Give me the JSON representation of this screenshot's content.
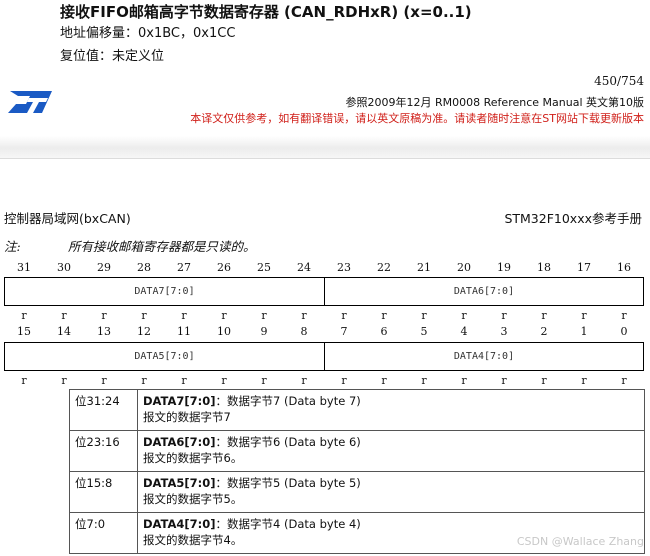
{
  "header": {
    "title": "接收FIFO邮箱高字节数据寄存器 (CAN_RDHxR) (x=0..1)",
    "offset": "地址偏移量：0x1BC，0x1CC",
    "reset": "复位值：未定义位"
  },
  "page_header": {
    "page_number": "450/754",
    "reference_line": "参照2009年12月 RM0008 Reference Manual 英文第10版",
    "disclaimer": "本译文仅供参考，如有翻译错误，请以英文原稿为准。请读者随时注意在ST网站下载更新版本",
    "logo_icon": "st-logo-icon",
    "logo_color": "#1a5ac4"
  },
  "section": {
    "left": "控制器局域网(bxCAN)",
    "right": "STM32F10xxx参考手册"
  },
  "note": {
    "label": "注:",
    "text": "所有接收邮箱寄存器都是只读的。"
  },
  "register": {
    "upper_bits": [
      "31",
      "30",
      "29",
      "28",
      "27",
      "26",
      "25",
      "24",
      "23",
      "22",
      "21",
      "20",
      "19",
      "18",
      "17",
      "16"
    ],
    "lower_bits": [
      "15",
      "14",
      "13",
      "12",
      "11",
      "10",
      "9",
      "8",
      "7",
      "6",
      "5",
      "4",
      "3",
      "2",
      "1",
      "0"
    ],
    "upper_fields": [
      "DATA7[7:0]",
      "DATA6[7:0]"
    ],
    "lower_fields": [
      "DATA5[7:0]",
      "DATA4[7:0]"
    ],
    "access": [
      "r",
      "r",
      "r",
      "r",
      "r",
      "r",
      "r",
      "r",
      "r",
      "r",
      "r",
      "r",
      "r",
      "r",
      "r",
      "r"
    ]
  },
  "descriptions": [
    {
      "bits": "位31:24",
      "name": "DATA7[7:0]",
      "sep": "：",
      "desc": "数据字节7 (Data byte 7)",
      "detail": "报文的数据字节7"
    },
    {
      "bits": "位23:16",
      "name": "DATA6[7:0]",
      "sep": "：",
      "desc": "数据字节6 (Data byte 6)",
      "detail": "报文的数据字节6。"
    },
    {
      "bits": "位15:8",
      "name": "DATA5[7:0]",
      "sep": "：",
      "desc": "数据字节5 (Data byte 5)",
      "detail": "报文的数据字节5。"
    },
    {
      "bits": "位7:0",
      "name": "DATA4[7:0]",
      "sep": "：",
      "desc": "数据字节4 (Data byte 4)",
      "detail": "报文的数据字节4。"
    }
  ],
  "watermark": "CSDN @Wallace Zhang"
}
